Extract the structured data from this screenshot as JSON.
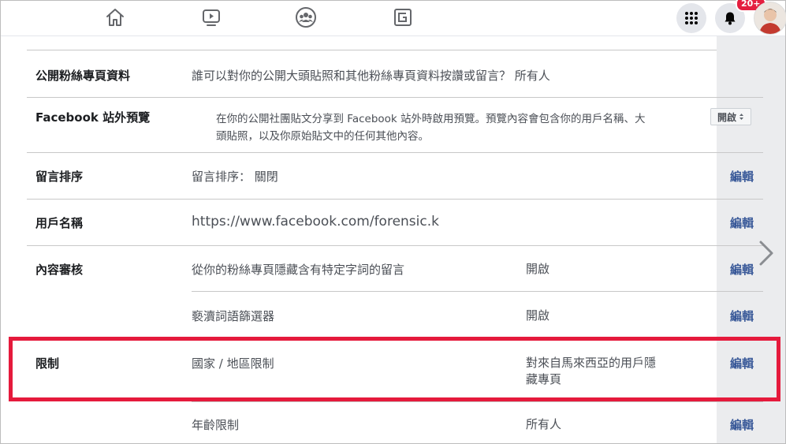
{
  "topbar": {
    "nav_icons": [
      "home-icon",
      "watch-icon",
      "groups-icon",
      "gaming-icon"
    ],
    "notification_count": "20+"
  },
  "settings": {
    "public_profile": {
      "label": "公開粉絲專頁資料",
      "description": "誰可以對你的公開大頭貼照和其他粉絲專頁資料按讚或留言？ 所有人"
    },
    "offsite_preview": {
      "label": "Facebook 站外預覽",
      "description_line1": "在你的公開社團貼文分享到 Facebook 站外時啟用預覽。預覽內容會包含你的用戶名稱、大",
      "description_line2": "頭貼照，以及你原始貼文中的任何其他內容。",
      "toggle_value": "開啟"
    },
    "comment_ranking": {
      "label": "留言排序",
      "description": "留言排序： 關閉",
      "edit": "編輯"
    },
    "username": {
      "label": "用戶名稱",
      "value": "https://www.facebook.com/forensic.k",
      "edit": "編輯"
    },
    "moderation": {
      "label": "內容審核",
      "item1_desc": "從你的粉絲專頁隱藏含有特定字詞的留言",
      "item1_value": "開啟",
      "item1_edit": "編輯",
      "item2_desc": "褻瀆詞語篩選器",
      "item2_value": "開啟",
      "item2_edit": "編輯"
    },
    "restrictions": {
      "label": "限制",
      "country_desc": "國家 / 地區限制",
      "country_value_line1": "對來自馬來西亞的用戶隱",
      "country_value_line2": "藏專頁",
      "country_edit": "編輯",
      "age_desc": "年齡限制",
      "age_value": "所有人",
      "age_edit": "編輯"
    }
  },
  "colors": {
    "link": "#385898",
    "highlight": "#e51a3c",
    "badge": "#e41e3f"
  }
}
